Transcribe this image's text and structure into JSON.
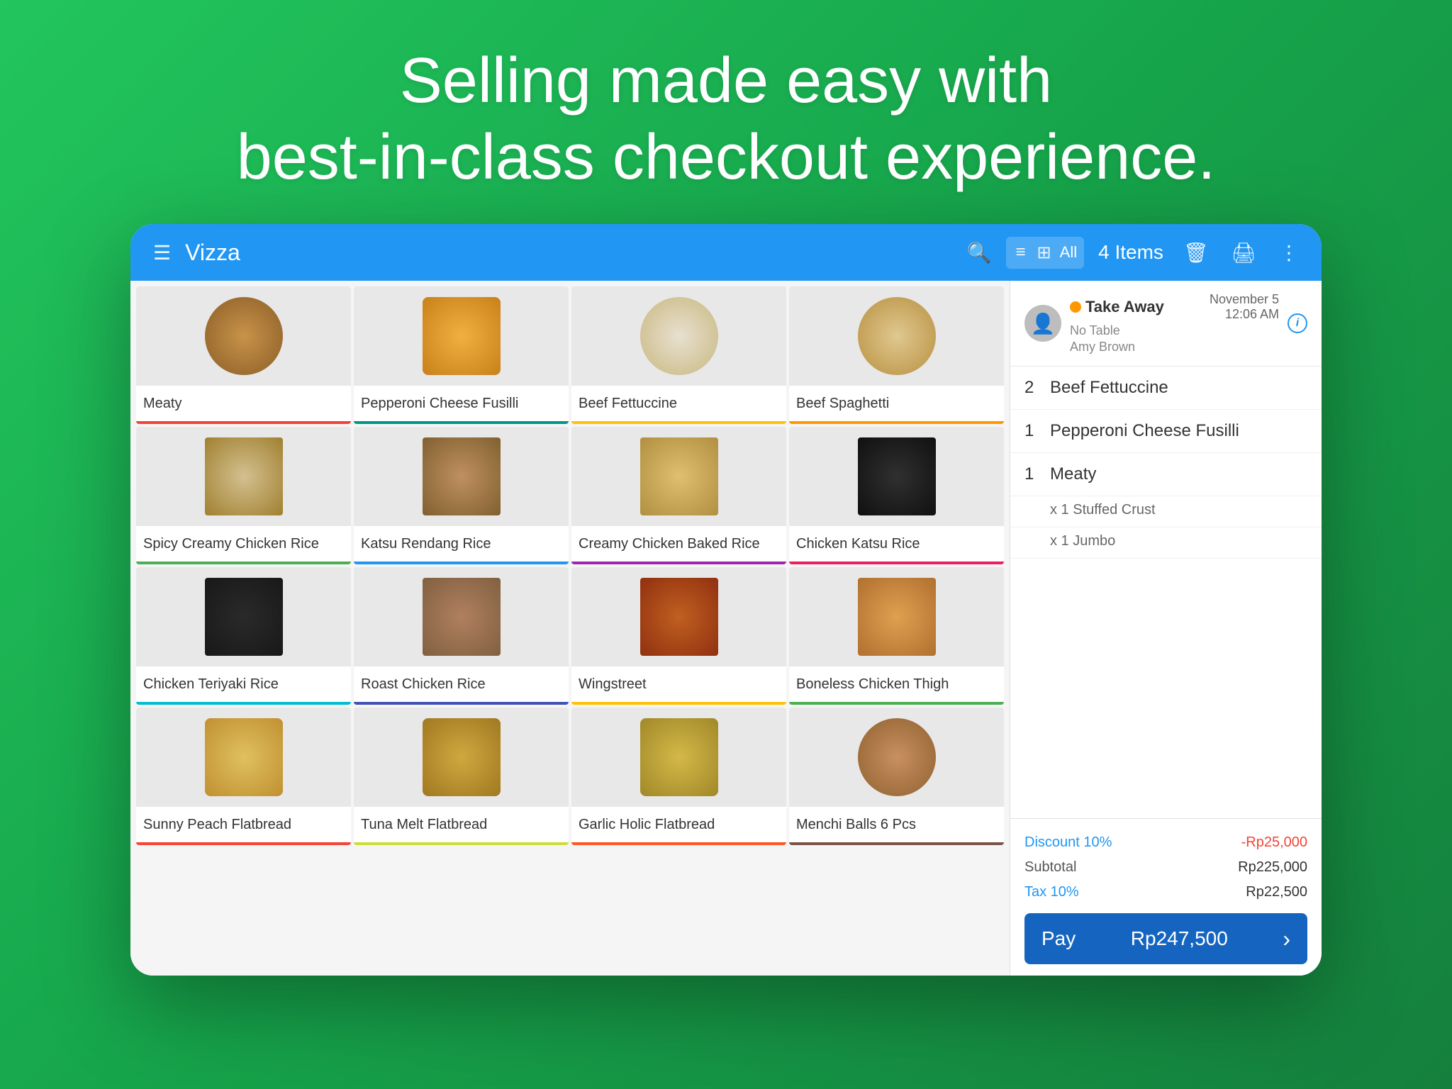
{
  "hero": {
    "line1": "Selling made easy with",
    "line2": "best-in-class checkout experience."
  },
  "topbar": {
    "appName": "Vizza",
    "allLabel": "All",
    "itemsCount": "4 Items"
  },
  "menuItems": [
    {
      "name": "Meaty",
      "colorBar": "color-bar-red",
      "foodClass": "food-pizza"
    },
    {
      "name": "Pepperoni Cheese Fusilli",
      "colorBar": "color-bar-teal",
      "foodClass": "food-pasta"
    },
    {
      "name": "Beef Fettuccine",
      "colorBar": "color-bar-amber",
      "foodClass": "food-fettuccine"
    },
    {
      "name": "Beef Spaghetti",
      "colorBar": "color-bar-orange",
      "foodClass": "food-spaghetti"
    },
    {
      "name": "Spicy Creamy Chicken Rice",
      "colorBar": "color-bar-green",
      "foodClass": "food-rice-spicy"
    },
    {
      "name": "Katsu Rendang Rice",
      "colorBar": "color-bar-blue",
      "foodClass": "food-katsu-rendang"
    },
    {
      "name": "Creamy Chicken Baked Rice",
      "colorBar": "color-bar-purple",
      "foodClass": "food-creamy-baked"
    },
    {
      "name": "Chicken Katsu Rice",
      "colorBar": "color-bar-pink",
      "foodClass": "food-chicken-katsu"
    },
    {
      "name": "Chicken Teriyaki Rice",
      "colorBar": "color-bar-cyan",
      "foodClass": "food-teriyaki"
    },
    {
      "name": "Roast Chicken Rice",
      "colorBar": "color-bar-indigo",
      "foodClass": "food-roast-rice"
    },
    {
      "name": "Wingstreet",
      "colorBar": "color-bar-amber",
      "foodClass": "food-wingstreet"
    },
    {
      "name": "Boneless Chicken Thigh",
      "colorBar": "color-bar-green",
      "foodClass": "food-boneless"
    },
    {
      "name": "Sunny Peach Flatbread",
      "colorBar": "color-bar-red",
      "foodClass": "food-sunny-peach"
    },
    {
      "name": "Tuna Melt Flatbread",
      "colorBar": "color-bar-lime",
      "foodClass": "food-tuna-melt"
    },
    {
      "name": "Garlic Holic Flatbread",
      "colorBar": "color-bar-deeporange",
      "foodClass": "food-garlic"
    },
    {
      "name": "Menchi Balls 6 Pcs",
      "colorBar": "color-bar-brown",
      "foodClass": "food-menchi"
    }
  ],
  "order": {
    "type": "Take Away",
    "date": "November 5",
    "time": "12:06 AM",
    "tableLabel": "No Table",
    "staffName": "Amy Brown",
    "items": [
      {
        "qty": "2",
        "name": "Beef Fettuccine",
        "subs": []
      },
      {
        "qty": "1",
        "name": "Pepperoni Cheese Fusilli",
        "subs": []
      },
      {
        "qty": "1",
        "name": "Meaty",
        "subs": [
          {
            "label": "x 1 Stuffed Crust"
          },
          {
            "label": "x 1 Jumbo"
          }
        ]
      }
    ],
    "discount": {
      "label": "Discount 10%",
      "value": "-Rp25,000"
    },
    "subtotal": {
      "label": "Subtotal",
      "value": "Rp225,000"
    },
    "tax": {
      "label": "Tax 10%",
      "value": "Rp22,500"
    },
    "pay": {
      "label": "Pay",
      "amount": "Rp247,500"
    }
  }
}
